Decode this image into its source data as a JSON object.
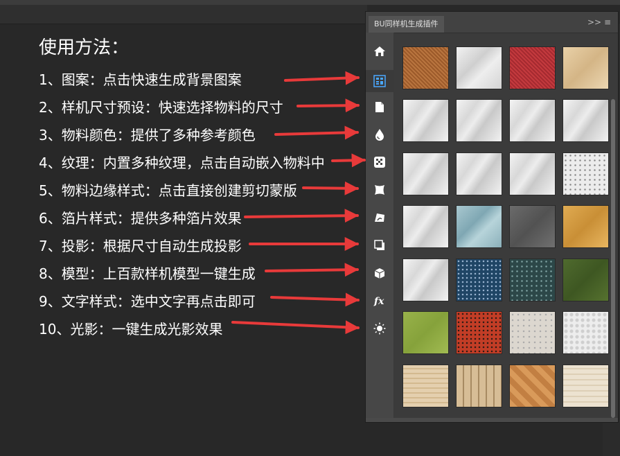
{
  "instructions": {
    "title": "使用方法：",
    "items": [
      "1、图案：点击快速生成背景图案",
      "2、样机尺寸预设：快速选择物料的尺寸",
      "3、物料颜色：提供了多种参考颜色",
      "4、纹理：内置多种纹理，点击自动嵌入物料中",
      "5、物料边缘样式：点击直接创建剪切蒙版",
      "6、箔片样式：提供多种箔片效果",
      "7、投影：根据尺寸自动生成投影",
      "8、模型：上百款样机模型一键生成",
      "9、文字样式：选中文字再点击即可",
      "10、光影：一键生成光影效果"
    ]
  },
  "panel": {
    "tab_title": "BU同样机生成插件",
    "collapse_glyph": ">>",
    "menu_glyph": "≡",
    "icons": [
      "home-icon",
      "pattern-icon",
      "document-icon",
      "color-drop-icon",
      "texture-icon",
      "edge-style-icon",
      "foil-icon",
      "shadow-icon",
      "model-cube-icon",
      "fx-icon",
      "light-icon"
    ]
  },
  "textures": [
    [
      "burlap",
      "white-paper",
      "red-fabric",
      "sand-paper"
    ],
    [
      "marble",
      "marble",
      "marble",
      "marble"
    ],
    [
      "marble",
      "marble",
      "marble",
      "speckled-white"
    ],
    [
      "marble",
      "blue-marble",
      "gray-stone",
      "gold-paper"
    ],
    [
      "marble",
      "blue-terrazzo",
      "teal-terrazzo",
      "green-felt"
    ],
    [
      "green-paper",
      "red-terrazzo",
      "beige-stone",
      "white-leather"
    ],
    [
      "light-wood",
      "wood-planks",
      "parquet",
      "pale-wood"
    ]
  ],
  "colors": {
    "arrow": "#e83a3a",
    "bg": "#282828",
    "panel": "#535353"
  }
}
